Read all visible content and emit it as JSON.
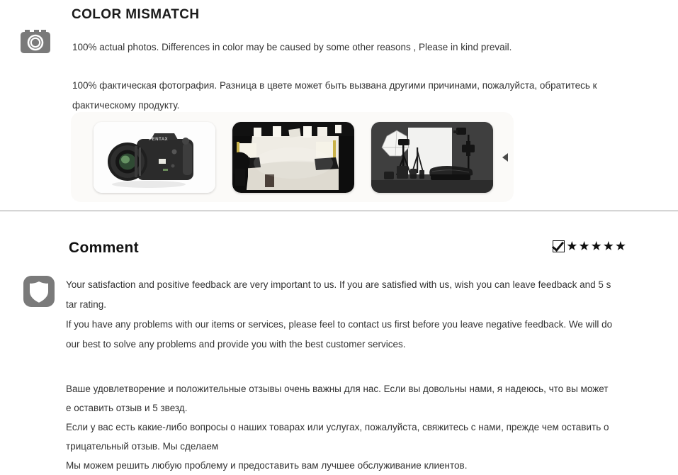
{
  "color_mismatch": {
    "icon": "camera-icon",
    "title": "COLOR MISMATCH",
    "text_en": "100% actual photos. Differences in color may be caused by some other reasons , Please in kind prevail.",
    "text_ru": "100% фактическая фотография. Разница в цвете может быть вызвана другими причинами, пожалуйста, обратитесь к фактическому продукту.",
    "gallery": {
      "next_arrow": "▶",
      "items": [
        {
          "alt": "dslr-camera-photo",
          "label": "PENTAX"
        },
        {
          "alt": "photo-studio-lighting-photo",
          "label": ""
        },
        {
          "alt": "studio-equipment-softbox-photo",
          "label": ""
        }
      ]
    }
  },
  "comment": {
    "icon": "shield-icon",
    "title": "Comment",
    "rating": {
      "checkbox_checked": true,
      "stars": 5,
      "star_glyph": "★",
      "star_color": "#111111"
    },
    "text_en_line1": "Your satisfaction and positive feedback are very important to us. If you are satisfied with us, wish you can leave feedback and 5 s",
    "text_en_line2": "tar rating.",
    "text_en_line3": "If you have any problems with our items or services, please feel to contact us first before you leave negative feedback. We will do",
    "text_en_line4": "our best to solve any problems and provide you with the best customer services.",
    "text_ru_line1": "Ваше удовлетворение и положительные отзывы очень важны для нас. Если вы довольны нами, я надеюсь, что вы может",
    "text_ru_line2": "е оставить отзыв и 5 звезд.",
    "text_ru_line3": "Если у вас есть какие-либо вопросы о наших товарах или услугах, пожалуйста, свяжитесь с нами, прежде чем оставить о",
    "text_ru_line4": "трицательный отзыв. Мы сделаем",
    "text_ru_line5": "Мы можем решить любую проблему и предоставить вам лучшее обслуживание клиентов."
  },
  "colors": {
    "icon_gray": "#7a7a7a",
    "divider": "#9a9a9a",
    "text": "#333333",
    "gallery_bg": "#fbfaf8"
  }
}
